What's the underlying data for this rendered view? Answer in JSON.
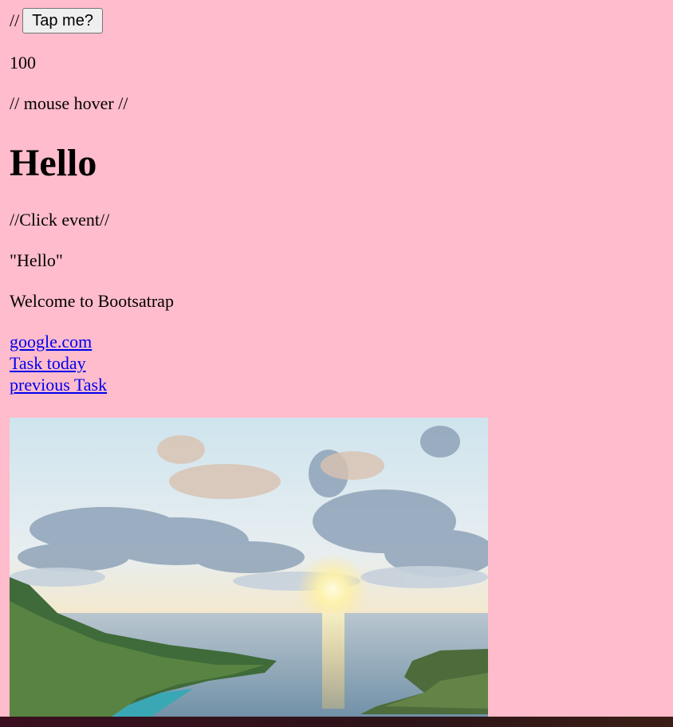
{
  "tap_row": {
    "prefix": "//",
    "button_label": "Tap me?"
  },
  "counter_value": "100",
  "mouse_hover_text": "// mouse hover //",
  "heading": "Hello",
  "click_event_text": "//Click event//",
  "quoted_hello": "\"Hello\"",
  "welcome_text": "Welcome to Bootsatrap",
  "links": [
    {
      "label": "google.com"
    },
    {
      "label": "Task today"
    },
    {
      "label": "previous Task"
    }
  ],
  "colors": {
    "page_background": "#ffbccc",
    "link": "#0000ee"
  }
}
